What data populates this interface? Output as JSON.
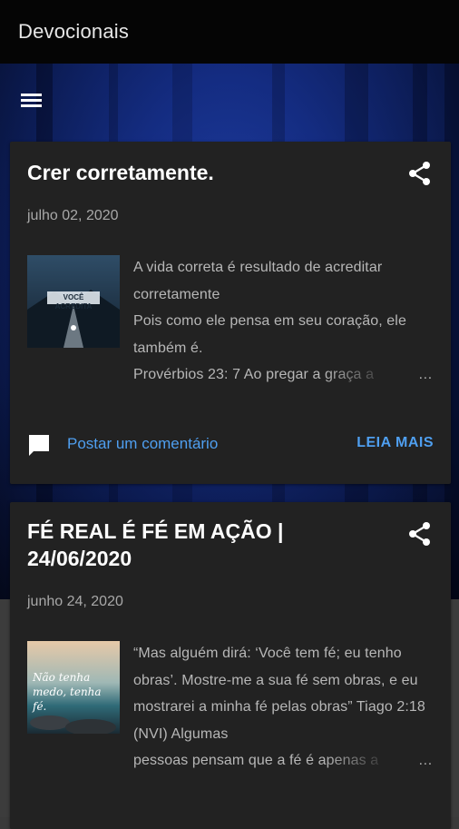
{
  "app": {
    "title": "Devocionais"
  },
  "posts": [
    {
      "title": "Crer corretamente.",
      "date": "julho 02, 2020",
      "image_text": "VOCÊ ACREDITA",
      "snippet_lines": [
        "A vida correta é resultado de acreditar corretamente",
        "Pois como ele pensa em seu coração, ele também é.",
        "Provérbios 23: 7 Ao pregar a graça a"
      ],
      "ellipsis": "…",
      "comment_label": "Postar um comentário",
      "read_more": "LEIA MAIS"
    },
    {
      "title": "FÉ REAL É FÉ EM AÇÃO | 24/06/2020",
      "date": "junho 24, 2020",
      "image_text": "Não tenha medo, tenha fé.",
      "snippet_lines": [
        "“Mas alguém dirá: ‘Você tem fé; eu tenho obras’. Mostre-me a sua fé sem obras, e eu mostrarei a minha fé pelas obras” Tiago 2:18 (NVI) Algumas",
        "pessoas pensam que a fé é apenas a"
      ],
      "ellipsis": "…"
    }
  ],
  "icons": {
    "menu": "menu-icon",
    "share": "share-icon",
    "comment": "comment-icon"
  },
  "colors": {
    "appbar": "#050505",
    "card": "#222222",
    "accent": "#4f9ff0"
  }
}
